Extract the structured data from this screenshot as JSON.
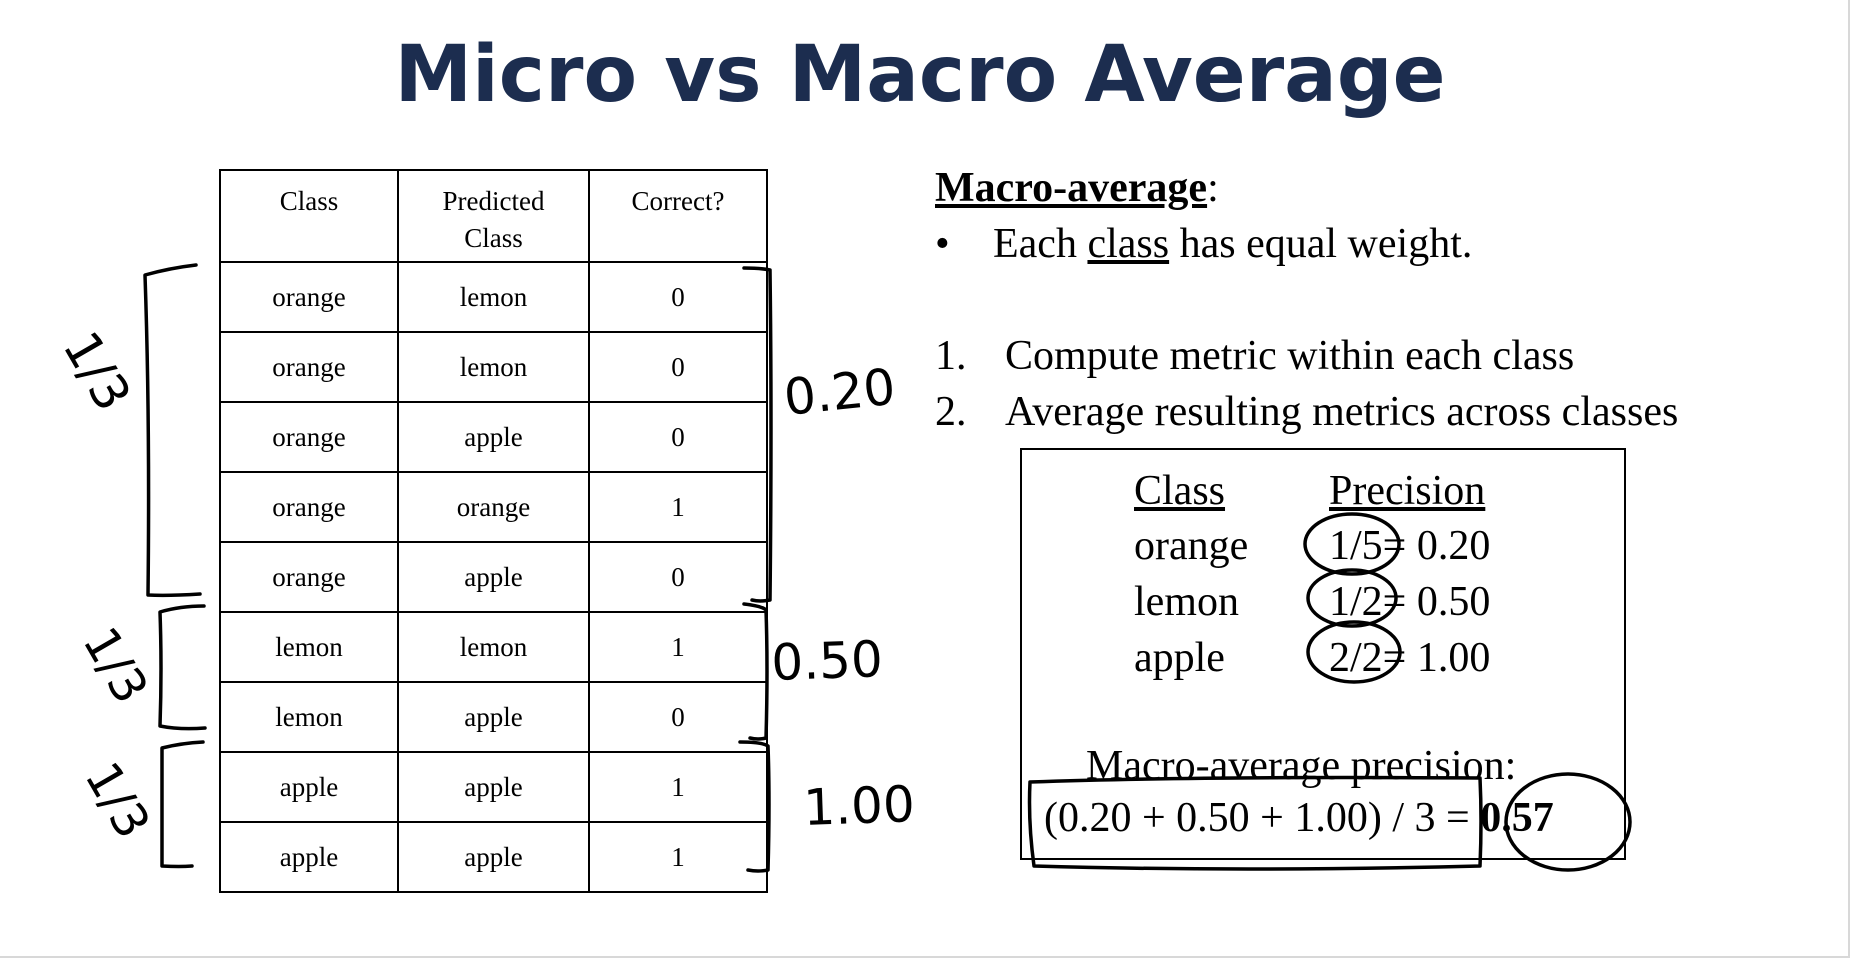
{
  "title": "Micro vs Macro Average",
  "table": {
    "headers": [
      "Class",
      "Predicted\nClass",
      "Correct?"
    ],
    "rows": [
      [
        "orange",
        "lemon",
        "0"
      ],
      [
        "orange",
        "lemon",
        "0"
      ],
      [
        "orange",
        "apple",
        "0"
      ],
      [
        "orange",
        "orange",
        "1"
      ],
      [
        "orange",
        "apple",
        "0"
      ],
      [
        "lemon",
        "lemon",
        "1"
      ],
      [
        "lemon",
        "apple",
        "0"
      ],
      [
        "apple",
        "apple",
        "1"
      ],
      [
        "apple",
        "apple",
        "1"
      ]
    ]
  },
  "annotations": {
    "weights": [
      "1/3",
      "1/3",
      "1/3"
    ],
    "group_values": [
      "0.20",
      "0.50",
      "1.00"
    ]
  },
  "macro": {
    "heading": "Macro-average",
    "heading_suffix": ":",
    "bullet_pre": "Each ",
    "bullet_u": "class",
    "bullet_post": " has equal weight.",
    "bullet_symbol": "•",
    "steps": [
      {
        "num": "1.",
        "text": "Compute metric within each class"
      },
      {
        "num": "2.",
        "text": "Average resulting metrics across classes"
      }
    ]
  },
  "precision_box": {
    "col_class": "Class",
    "col_precision": "Precision",
    "rows": [
      {
        "cls": "orange",
        "frac": "1/5",
        "val": "= 0.20"
      },
      {
        "cls": "lemon",
        "frac": "1/2",
        "val": "= 0.50"
      },
      {
        "cls": "apple",
        "frac": "2/2",
        "val": "= 1.00"
      }
    ],
    "macro_label": "Macro-average precision:",
    "formula": "(0.20 + 0.50 + 1.00) / 3 = ",
    "result": "0.57"
  }
}
